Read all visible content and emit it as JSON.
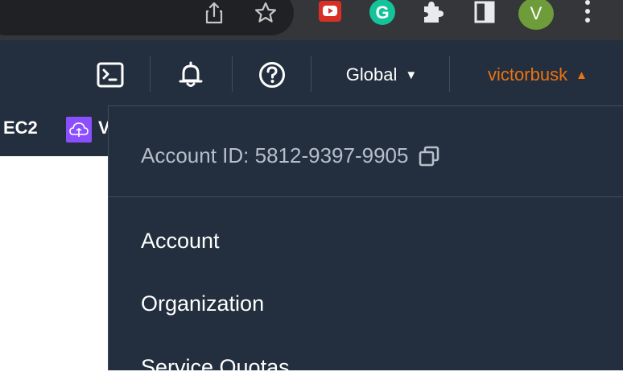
{
  "browser": {
    "toolbar_icons": [
      "share-icon",
      "star-icon",
      "youtube-extension-icon",
      "grammarly-extension-icon",
      "extensions-puzzle-icon",
      "side-panel-icon",
      "more-vertical-icon"
    ],
    "profile_initial": "V",
    "profile_color": "#6f9c3a"
  },
  "nav": {
    "region_label": "Global",
    "account_label": "victorbusk",
    "accent_color": "#ec7211",
    "background_color": "#232f3e"
  },
  "favorites": {
    "items": [
      {
        "label": "EC2"
      },
      {
        "label": "V"
      }
    ]
  },
  "account_dropdown": {
    "account_id_label": "Account ID: 5812-9397-9905",
    "menu_items": [
      {
        "label": "Account"
      },
      {
        "label": "Organization"
      },
      {
        "label": "Service Quotas"
      }
    ]
  }
}
